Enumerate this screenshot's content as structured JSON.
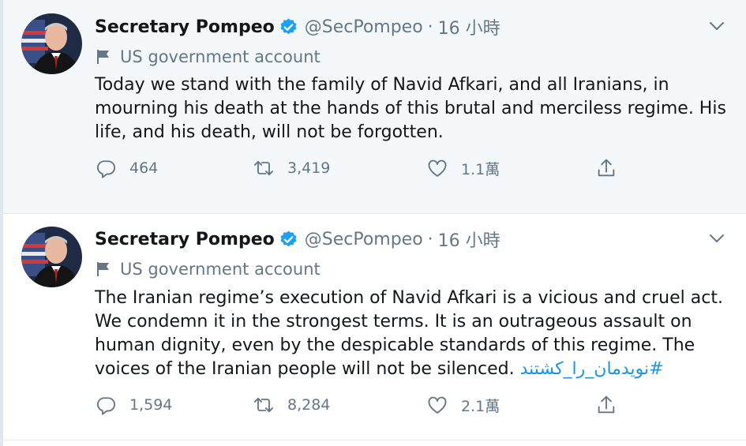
{
  "tweets": [
    {
      "author": "Secretary Pompeo",
      "handle": "@SecPompeo",
      "separator": "·",
      "time": "16 小時",
      "label": "US government account",
      "text": "Today we stand with the family of Navid Afkari, and all Iranians, in mourning his death at the hands of this brutal and merciless regime. His life, and his death, will not be forgotten.",
      "hashtag": "",
      "replies": "464",
      "retweets": "3,419",
      "likes": "1.1萬"
    },
    {
      "author": "Secretary Pompeo",
      "handle": "@SecPompeo",
      "separator": "·",
      "time": "16 小時",
      "label": "US government account",
      "text": "The Iranian regime’s execution of Navid Afkari is a vicious and cruel act. We condemn it in the strongest terms. It is an outrageous assault on human dignity, even by the despicable standards of this regime. The voices of the Iranian people will not be silenced. ",
      "hashtag": "#نویدمان_را_کشتند",
      "replies": "1,594",
      "retweets": "8,284",
      "likes": "2.1萬"
    }
  ],
  "icons": {
    "verified": "verified-badge-icon",
    "caret": "chevron-down-icon",
    "label": "flag-icon",
    "reply": "reply-icon",
    "retweet": "retweet-icon",
    "like": "heart-icon",
    "share": "share-icon"
  },
  "colors": {
    "accent": "#1da1f2",
    "hashtag": "#1b95e0",
    "secondary_text": "#657786",
    "highlight_bg": "#f5f8fa"
  }
}
